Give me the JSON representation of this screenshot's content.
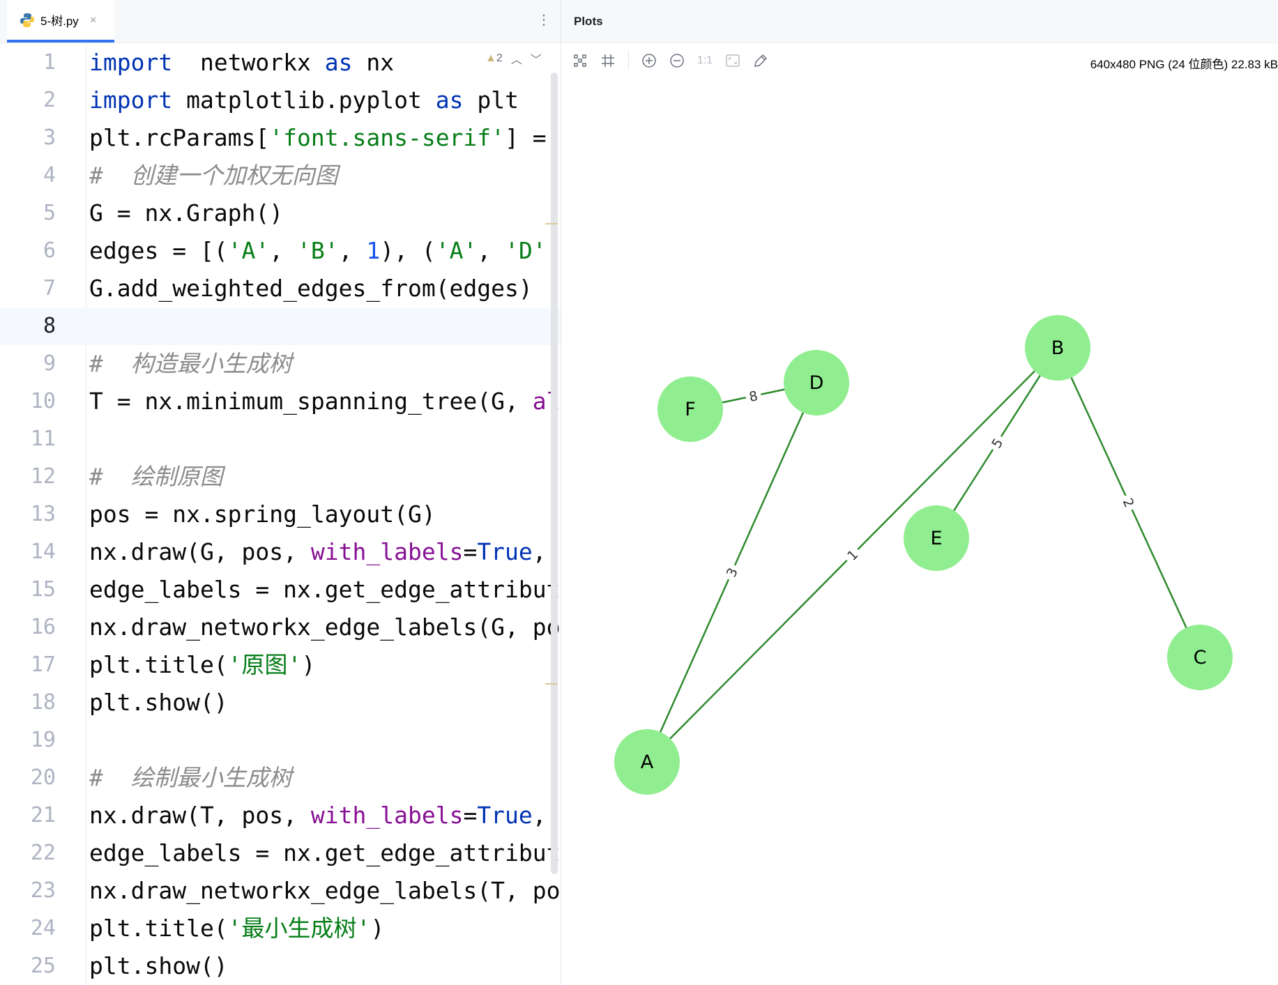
{
  "editor": {
    "tab": {
      "filename": "5-树.py",
      "icon": "python-icon",
      "close": "×"
    },
    "inspection": {
      "warnings": "2",
      "icon": "warning-icon"
    },
    "current_line": 8,
    "lines": [
      [
        [
          "k",
          "import"
        ],
        [
          "",
          "  networkx "
        ],
        [
          "k",
          "as"
        ],
        [
          "",
          " nx"
        ]
      ],
      [
        [
          "k",
          "import"
        ],
        [
          "",
          " matplotlib.pyplot "
        ],
        [
          "k",
          "as"
        ],
        [
          "",
          " plt"
        ]
      ],
      [
        [
          "",
          "plt.rcParams["
        ],
        [
          "s",
          "'font.sans-serif'"
        ],
        [
          "",
          "] ="
        ]
      ],
      [
        [
          "c",
          "#  创建一个加权无向图"
        ]
      ],
      [
        [
          "",
          "G = nx.Graph()"
        ]
      ],
      [
        [
          "",
          "edges = [("
        ],
        [
          "s",
          "'A'"
        ],
        [
          "",
          ", "
        ],
        [
          "s",
          "'B'"
        ],
        [
          "",
          ", "
        ],
        [
          "n",
          "1"
        ],
        [
          "",
          "), ("
        ],
        [
          "s",
          "'A'"
        ],
        [
          "",
          ", "
        ],
        [
          "s",
          "'D'"
        ],
        [
          "",
          ","
        ]
      ],
      [
        [
          "",
          "G.add_weighted_edges_from(edges)"
        ]
      ],
      [],
      [
        [
          "c",
          "#  构造最小生成树"
        ]
      ],
      [
        [
          "",
          "T = nx.minimum_spanning_tree(G, "
        ],
        [
          "p",
          "al"
        ]
      ],
      [],
      [
        [
          "c",
          "#  绘制原图"
        ]
      ],
      [
        [
          "",
          "pos = nx.spring_layout(G)"
        ]
      ],
      [
        [
          "",
          "nx.draw(G, pos, "
        ],
        [
          "p",
          "with_labels"
        ],
        [
          "",
          "="
        ],
        [
          "k",
          "True"
        ],
        [
          "",
          ","
        ]
      ],
      [
        [
          "",
          "edge_labels = nx.get_edge_attribut"
        ]
      ],
      [
        [
          "",
          "nx.draw_networkx_edge_labels(G, po"
        ]
      ],
      [
        [
          "",
          "plt.title("
        ],
        [
          "s",
          "'原图'"
        ],
        [
          "",
          ")"
        ]
      ],
      [
        [
          "",
          "plt.show()"
        ]
      ],
      [],
      [
        [
          "c",
          "#  绘制最小生成树"
        ]
      ],
      [
        [
          "",
          "nx.draw(T, pos, "
        ],
        [
          "p",
          "with_labels"
        ],
        [
          "",
          "="
        ],
        [
          "k",
          "True"
        ],
        [
          "",
          ","
        ]
      ],
      [
        [
          "",
          "edge_labels = nx.get_edge_attribut"
        ]
      ],
      [
        [
          "",
          "nx.draw_networkx_edge_labels(T, po"
        ]
      ],
      [
        [
          "",
          "plt.title("
        ],
        [
          "s",
          "'最小生成树'"
        ],
        [
          "",
          ")"
        ]
      ],
      [
        [
          "",
          "plt.show()"
        ]
      ]
    ]
  },
  "plots": {
    "title": "Plots",
    "toolbar": [
      "fit-icon",
      "grid-icon",
      "zoom-in-icon",
      "zoom-out-icon",
      "actual-size-icon",
      "fit-window-icon",
      "color-picker-icon"
    ],
    "actual_size_label": "1:1",
    "image_info": "640x480 PNG (24 位颜色) 22.83 kB"
  },
  "graph": {
    "node_color": "#90ee90",
    "edge_color": "#2e8b2e",
    "nodes": [
      "A",
      "B",
      "C",
      "D",
      "E",
      "F"
    ],
    "edges": [
      {
        "u": "F",
        "v": "D",
        "weight": "8"
      },
      {
        "u": "D",
        "v": "A",
        "weight": "3"
      },
      {
        "u": "A",
        "v": "B",
        "weight": "1"
      },
      {
        "u": "B",
        "v": "E",
        "weight": "5"
      },
      {
        "u": "B",
        "v": "C",
        "weight": "2"
      }
    ]
  }
}
